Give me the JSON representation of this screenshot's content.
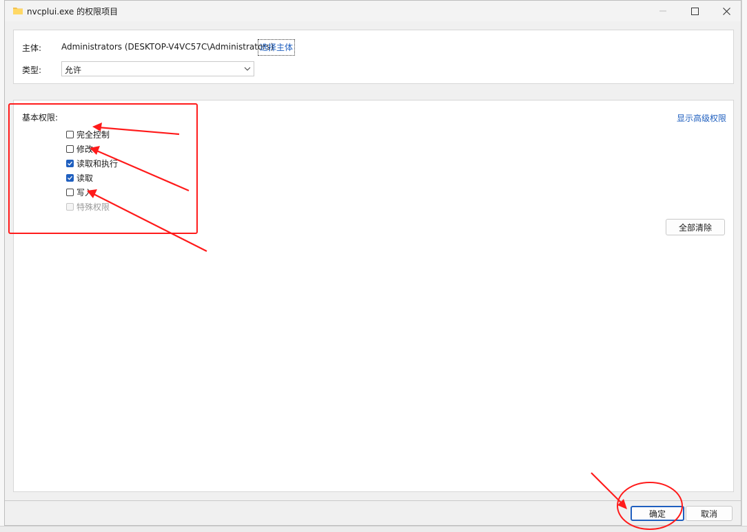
{
  "window": {
    "title": "nvcplui.exe 的权限项目",
    "icon": "folder-icon",
    "controls": {
      "minimize": "minimize-icon",
      "maximize": "maximize-icon",
      "close": "close-icon"
    }
  },
  "principal": {
    "label": "主体:",
    "value": "Administrators (DESKTOP-V4VC57C\\Administrators)",
    "select_button": "选择主体"
  },
  "type": {
    "label": "类型:",
    "selected": "允许"
  },
  "permissions": {
    "heading": "基本权限:",
    "show_advanced": "显示高级权限",
    "clear_all": "全部清除",
    "items": [
      {
        "label": "完全控制",
        "checked": false,
        "disabled": false
      },
      {
        "label": "修改",
        "checked": false,
        "disabled": false
      },
      {
        "label": "读取和执行",
        "checked": true,
        "disabled": false
      },
      {
        "label": "读取",
        "checked": true,
        "disabled": false
      },
      {
        "label": "写入",
        "checked": false,
        "disabled": false
      },
      {
        "label": "特殊权限",
        "checked": false,
        "disabled": true
      }
    ]
  },
  "footer": {
    "ok": "确定",
    "cancel": "取消"
  },
  "colors": {
    "accent": "#1f5fbf",
    "annotation": "#ff1a1a"
  }
}
